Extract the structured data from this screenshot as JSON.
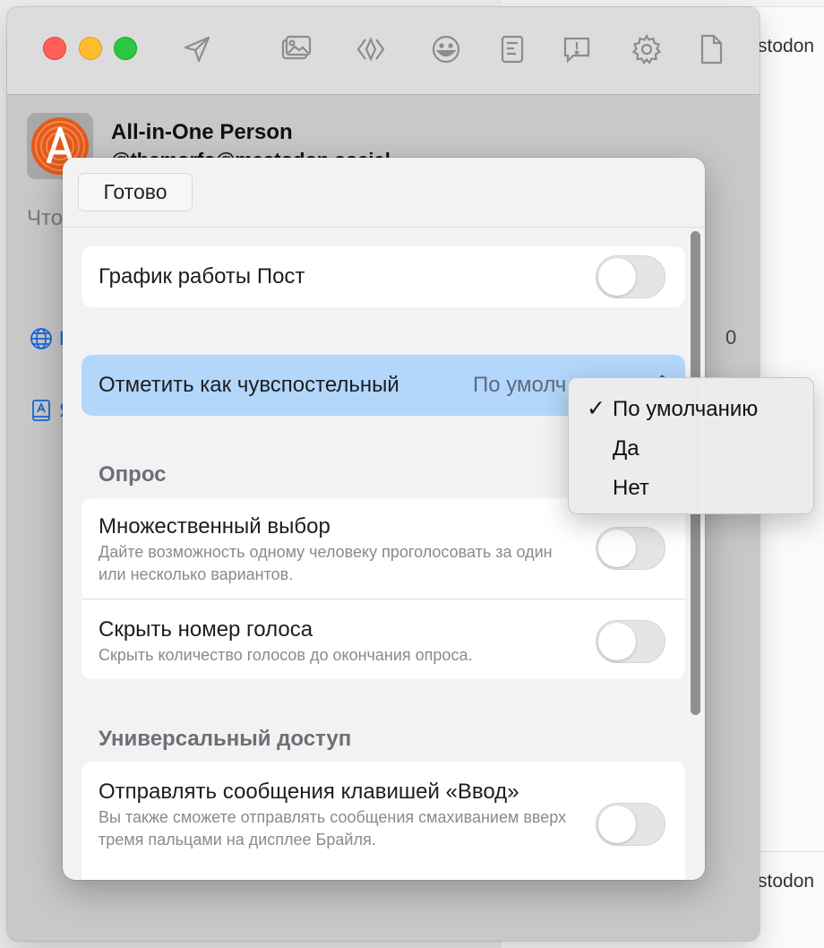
{
  "background_app": {
    "text_top": "stodon",
    "text_bottom": "stodon"
  },
  "window": {
    "toolbar_icons": [
      "send-icon",
      "image-icon",
      "code-tag-icon",
      "emoji-icon",
      "poll-icon",
      "content-warning-icon",
      "settings-gear-icon",
      "document-icon"
    ]
  },
  "account": {
    "name": "All-in-One Person",
    "handle": "@themorfo@mastodon.social"
  },
  "compose": {
    "placeholder": "Что"
  },
  "sidebar": {
    "globe_letter": "П",
    "book_letter": "Я",
    "char_count": "0"
  },
  "sheet": {
    "done_label": "Готово",
    "schedule": {
      "label": "График работы Пост"
    },
    "sensitive": {
      "label": "Отметить как чувспостельный",
      "value": "По умолч"
    },
    "poll": {
      "header": "Опрос",
      "multiple": {
        "title": "Множественный выбор",
        "subtitle": "Дайте возможность одному человеку проголосовать за один или несколько вариантов."
      },
      "hide_count": {
        "title": "Скрыть номер голоса",
        "subtitle": "Скрыть количество голосов до окончания опроса."
      }
    },
    "accessibility": {
      "header": "Универсальный доступ",
      "enter_send": {
        "title": "Отправлять сообщения клавишей «Ввод»",
        "subtitle": "Вы также сможете отправлять сообщения смахиванием вверх тремя пальцами на дисплее Брайля."
      }
    }
  },
  "menu": {
    "items": [
      {
        "label": "По умолчанию",
        "checked": true
      },
      {
        "label": "Да",
        "checked": false
      },
      {
        "label": "Нет",
        "checked": false
      }
    ],
    "check_glyph": "✓"
  },
  "colors": {
    "selection_blue": "#b3d6fb",
    "toggle_off": "#e5e5e8",
    "link_blue": "#1a66d9"
  }
}
